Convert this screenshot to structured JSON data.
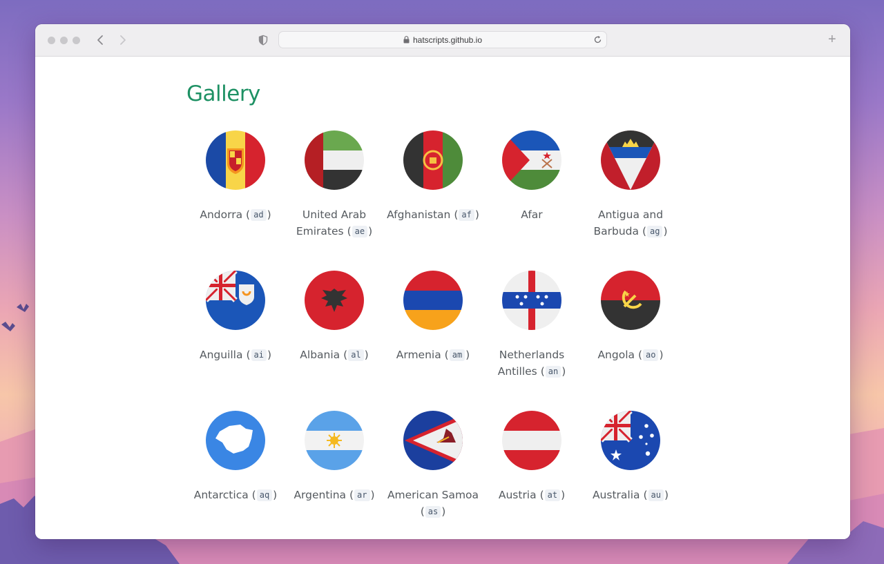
{
  "browser": {
    "url": "hatscripts.github.io",
    "back_icon": "chevron-left-icon",
    "forward_icon": "chevron-right-icon",
    "new_tab_label": "+"
  },
  "page": {
    "title": "Gallery",
    "title_color": "#1e9164"
  },
  "items": [
    {
      "name": "Andorra",
      "code": "ad"
    },
    {
      "name": "United Arab Emirates",
      "code": "ae"
    },
    {
      "name": "Afghanistan",
      "code": "af"
    },
    {
      "name": "Afar",
      "code": ""
    },
    {
      "name": "Antigua and Barbuda",
      "code": "ag"
    },
    {
      "name": "Anguilla",
      "code": "ai"
    },
    {
      "name": "Albania",
      "code": "al"
    },
    {
      "name": "Armenia",
      "code": "am"
    },
    {
      "name": "Netherlands Antilles",
      "code": "an"
    },
    {
      "name": "Angola",
      "code": "ao"
    },
    {
      "name": "Antarctica",
      "code": "aq"
    },
    {
      "name": "Argentina",
      "code": "ar"
    },
    {
      "name": "American Samoa",
      "code": "as"
    },
    {
      "name": "Austria",
      "code": "at"
    },
    {
      "name": "Australia",
      "code": "au"
    }
  ],
  "parens": {
    "open": "(",
    "close": ")"
  }
}
